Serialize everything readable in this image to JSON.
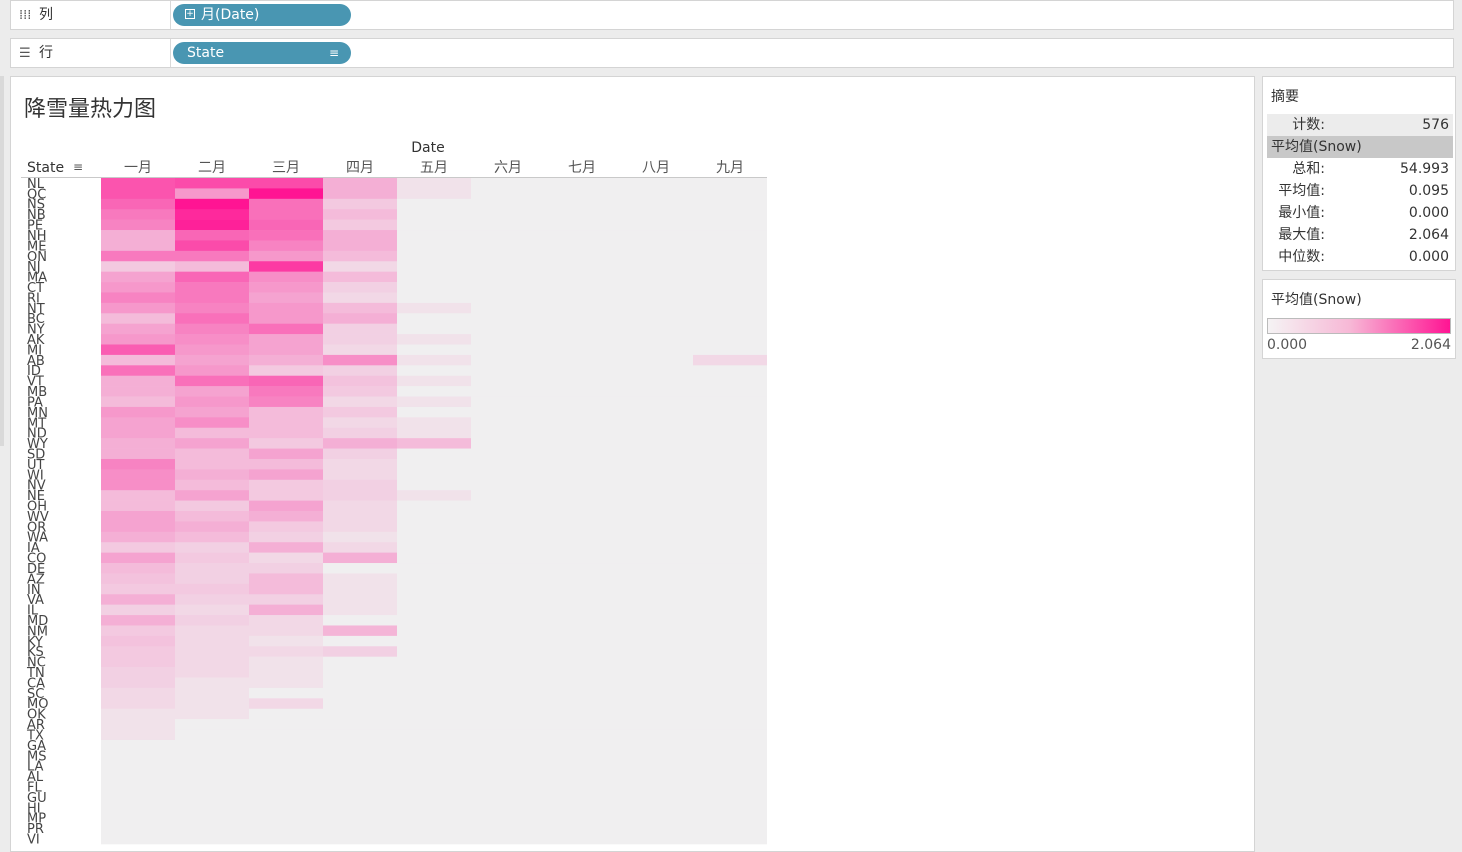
{
  "shelves": {
    "columns": {
      "label": "列",
      "icon": "columns-icon",
      "pill": "月(Date)"
    },
    "rows": {
      "label": "行",
      "icon": "rows-icon",
      "pill": "State"
    }
  },
  "sheet": {
    "title": "降雪量热力图"
  },
  "summary": {
    "title": "摘要",
    "count_label": "计数:",
    "count": "576",
    "measure_header": "平均值(Snow)",
    "stats": [
      {
        "label": "总和:",
        "value": "54.993"
      },
      {
        "label": "平均值:",
        "value": "0.095"
      },
      {
        "label": "最小值:",
        "value": "0.000"
      },
      {
        "label": "最大值:",
        "value": "2.064"
      },
      {
        "label": "中位数:",
        "value": "0.000"
      }
    ]
  },
  "legend": {
    "title": "平均值(Snow)",
    "min": "0.000",
    "max": "2.064"
  },
  "colors": {
    "low": "#f0eff0",
    "high": "#ff1493",
    "pill": "#4996b2"
  },
  "chart_data": {
    "type": "heatmap",
    "title": "降雪量热力图",
    "x_title": "Date",
    "y_title": "State",
    "color_measure": "平均值(Snow)",
    "color_range": [
      0,
      2.064
    ],
    "x": [
      "一月",
      "二月",
      "三月",
      "四月",
      "五月",
      "六月",
      "七月",
      "八月",
      "九月"
    ],
    "y": [
      "NL",
      "QC",
      "NS",
      "NB",
      "PE",
      "NH",
      "ME",
      "ON",
      "NJ",
      "MA",
      "CT",
      "RI",
      "NT",
      "BC",
      "NY",
      "AK",
      "MI",
      "AB",
      "ID",
      "VT",
      "MB",
      "PA",
      "MN",
      "MT",
      "ND",
      "WY",
      "SD",
      "UT",
      "WI",
      "NV",
      "NE",
      "OH",
      "WV",
      "OR",
      "WA",
      "IA",
      "CO",
      "DE",
      "AZ",
      "IN",
      "VA",
      "IL",
      "MD",
      "NM",
      "KY",
      "KS",
      "NC",
      "TN",
      "CA",
      "SC",
      "MO",
      "OK",
      "AR",
      "TX",
      "GA",
      "MS",
      "LA",
      "AL",
      "FL",
      "GU",
      "HI",
      "MP",
      "PR",
      "VI"
    ],
    "values": [
      [
        1.3,
        1.4,
        1.4,
        0.4,
        0.05,
        0,
        0,
        0,
        0
      ],
      [
        1.3,
        0.6,
        2.06,
        0.4,
        0.05,
        0,
        0,
        0,
        0
      ],
      [
        1.1,
        2.06,
        1.0,
        0.2,
        0,
        0,
        0,
        0,
        0
      ],
      [
        0.9,
        1.8,
        1.0,
        0.3,
        0,
        0,
        0,
        0,
        0
      ],
      [
        0.8,
        1.9,
        1.1,
        0.2,
        0,
        0,
        0,
        0,
        0
      ],
      [
        0.4,
        1.1,
        1.0,
        0.4,
        0,
        0,
        0,
        0,
        0
      ],
      [
        0.4,
        1.4,
        0.8,
        0.4,
        0,
        0,
        0,
        0,
        0
      ],
      [
        0.9,
        0.9,
        0.6,
        0.3,
        0,
        0,
        0,
        0,
        0
      ],
      [
        0.2,
        0.3,
        1.6,
        0.1,
        0,
        0,
        0,
        0,
        0
      ],
      [
        0.5,
        1.1,
        0.7,
        0.3,
        0,
        0,
        0,
        0,
        0
      ],
      [
        0.6,
        0.9,
        0.6,
        0.15,
        0,
        0,
        0,
        0,
        0
      ],
      [
        0.8,
        0.9,
        0.5,
        0.1,
        0,
        0,
        0,
        0,
        0
      ],
      [
        0.6,
        0.8,
        0.6,
        0.3,
        0.05,
        0,
        0,
        0,
        0
      ],
      [
        0.3,
        1.0,
        0.6,
        0.4,
        0,
        0,
        0,
        0,
        0
      ],
      [
        0.5,
        0.8,
        1.0,
        0.15,
        0,
        0,
        0,
        0,
        0
      ],
      [
        0.6,
        0.7,
        0.5,
        0.15,
        0.05,
        0,
        0,
        0,
        0
      ],
      [
        1.2,
        0.6,
        0.5,
        0.1,
        0,
        0,
        0,
        0,
        0
      ],
      [
        0.3,
        0.5,
        0.4,
        0.7,
        0.05,
        0,
        0,
        0,
        0.1
      ],
      [
        1.0,
        0.6,
        0.2,
        0.15,
        0,
        0,
        0,
        0,
        0
      ],
      [
        0.4,
        1.0,
        1.1,
        0.25,
        0.05,
        0,
        0,
        0,
        0
      ],
      [
        0.4,
        0.5,
        0.9,
        0.2,
        0,
        0,
        0,
        0,
        0
      ],
      [
        0.3,
        0.6,
        0.8,
        0.1,
        0.05,
        0,
        0,
        0,
        0
      ],
      [
        0.6,
        0.5,
        0.3,
        0.2,
        0,
        0,
        0,
        0,
        0
      ],
      [
        0.5,
        0.7,
        0.3,
        0.1,
        0.05,
        0,
        0,
        0,
        0
      ],
      [
        0.5,
        0.3,
        0.3,
        0.15,
        0.05,
        0,
        0,
        0,
        0
      ],
      [
        0.4,
        0.5,
        0.2,
        0.4,
        0.3,
        0,
        0,
        0,
        0
      ],
      [
        0.4,
        0.3,
        0.5,
        0.15,
        0,
        0,
        0,
        0,
        0
      ],
      [
        0.8,
        0.3,
        0.3,
        0.1,
        0,
        0,
        0,
        0,
        0
      ],
      [
        0.7,
        0.4,
        0.5,
        0.1,
        0,
        0,
        0,
        0,
        0
      ],
      [
        0.7,
        0.3,
        0.2,
        0.15,
        0,
        0,
        0,
        0,
        0
      ],
      [
        0.3,
        0.5,
        0.2,
        0.15,
        0.05,
        0,
        0,
        0,
        0
      ],
      [
        0.3,
        0.2,
        0.5,
        0.1,
        0,
        0,
        0,
        0,
        0
      ],
      [
        0.5,
        0.3,
        0.4,
        0.1,
        0,
        0,
        0,
        0,
        0
      ],
      [
        0.5,
        0.4,
        0.2,
        0.1,
        0,
        0,
        0,
        0,
        0
      ],
      [
        0.4,
        0.3,
        0.15,
        0.05,
        0,
        0,
        0,
        0,
        0
      ],
      [
        0.2,
        0.15,
        0.4,
        0.1,
        0,
        0,
        0,
        0,
        0
      ],
      [
        0.5,
        0.2,
        0.1,
        0.4,
        0,
        0,
        0,
        0,
        0
      ],
      [
        0.3,
        0.15,
        0.15,
        0,
        0,
        0,
        0,
        0,
        0
      ],
      [
        0.25,
        0.15,
        0.3,
        0.05,
        0,
        0,
        0,
        0,
        0
      ],
      [
        0.2,
        0.2,
        0.3,
        0.05,
        0,
        0,
        0,
        0,
        0
      ],
      [
        0.4,
        0.15,
        0.15,
        0.05,
        0,
        0,
        0,
        0,
        0
      ],
      [
        0.15,
        0.1,
        0.4,
        0.05,
        0,
        0,
        0,
        0,
        0
      ],
      [
        0.4,
        0.15,
        0.1,
        0,
        0,
        0,
        0,
        0,
        0
      ],
      [
        0.2,
        0.1,
        0.1,
        0.35,
        0,
        0,
        0,
        0,
        0
      ],
      [
        0.25,
        0.1,
        0.05,
        0,
        0,
        0,
        0,
        0,
        0
      ],
      [
        0.2,
        0.1,
        0.1,
        0.15,
        0,
        0,
        0,
        0,
        0
      ],
      [
        0.2,
        0.1,
        0.05,
        0,
        0,
        0,
        0,
        0,
        0
      ],
      [
        0.15,
        0.1,
        0.05,
        0,
        0,
        0,
        0,
        0,
        0
      ],
      [
        0.15,
        0.05,
        0.05,
        0,
        0,
        0,
        0,
        0,
        0
      ],
      [
        0.1,
        0.05,
        0,
        0,
        0,
        0,
        0,
        0,
        0
      ],
      [
        0.1,
        0.05,
        0.1,
        0,
        0,
        0,
        0,
        0,
        0
      ],
      [
        0.05,
        0.05,
        0,
        0,
        0,
        0,
        0,
        0,
        0
      ],
      [
        0.05,
        0,
        0,
        0,
        0,
        0,
        0,
        0,
        0
      ],
      [
        0.05,
        0,
        0,
        0,
        0,
        0,
        0,
        0,
        0
      ],
      [
        0,
        0,
        0,
        0,
        0,
        0,
        0,
        0,
        0
      ],
      [
        0,
        0,
        0,
        0,
        0,
        0,
        0,
        0,
        0
      ],
      [
        0,
        0,
        0,
        0,
        0,
        0,
        0,
        0,
        0
      ],
      [
        0,
        0,
        0,
        0,
        0,
        0,
        0,
        0,
        0
      ],
      [
        0,
        0,
        0,
        0,
        0,
        0,
        0,
        0,
        0
      ],
      [
        0,
        0,
        0,
        0,
        0,
        0,
        0,
        0,
        0
      ],
      [
        0,
        0,
        0,
        0,
        0,
        0,
        0,
        0,
        0
      ],
      [
        0,
        0,
        0,
        0,
        0,
        0,
        0,
        0,
        0
      ],
      [
        0,
        0,
        0,
        0,
        0,
        0,
        0,
        0,
        0
      ],
      [
        0,
        0,
        0,
        0,
        0,
        0,
        0,
        0,
        0
      ]
    ]
  }
}
